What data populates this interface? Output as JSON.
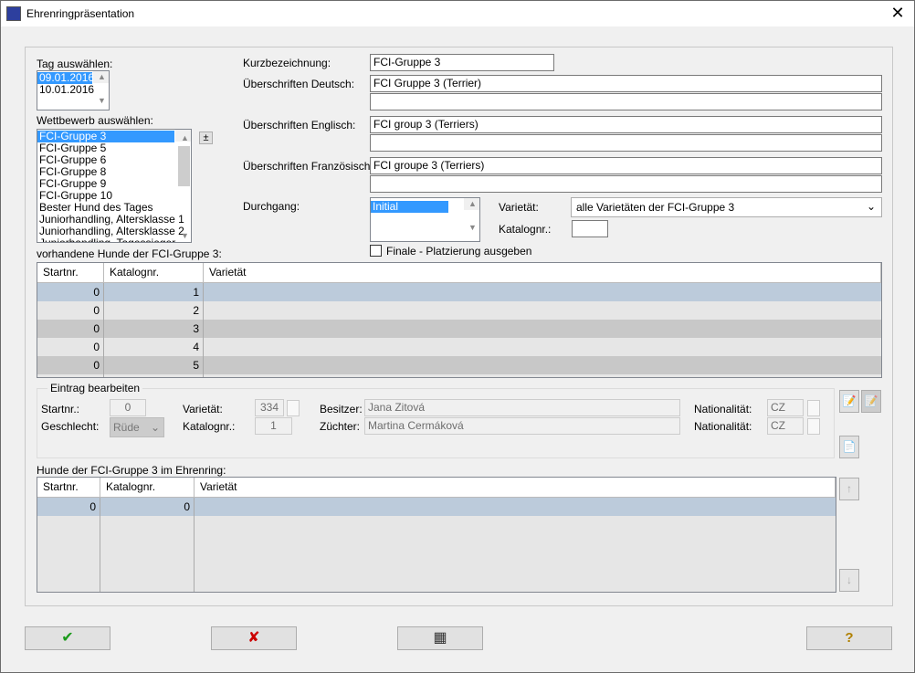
{
  "window": {
    "title": "Ehrenringpräsentation",
    "close": "✕"
  },
  "left": {
    "tag_label": "Tag auswählen:",
    "days": [
      "09.01.2016",
      "10.01.2016"
    ],
    "wettbewerb_label": "Wettbewerb auswählen:",
    "competitions": [
      "FCI-Gruppe 3",
      "FCI-Gruppe 5",
      "FCI-Gruppe 6",
      "FCI-Gruppe 8",
      "FCI-Gruppe 9",
      "FCI-Gruppe 10",
      "Bester Hund des Tages",
      "Juniorhandling, Altersklasse 1",
      "Juniorhandling, Altersklasse 2",
      "Juniorhandling, Tagessieger"
    ],
    "plusminus": "±"
  },
  "form": {
    "kurz_label": "Kurzbezeichnung:",
    "kurz": "FCI-Gruppe 3",
    "de_label": "Überschriften Deutsch:",
    "de1": "FCI Gruppe 3 (Terrier)",
    "de2": "",
    "en_label": "Überschriften Englisch:",
    "en1": "FCI group 3 (Terriers)",
    "en2": "",
    "fr_label": "Überschriften Französisch:",
    "fr1": "FCI groupe 3 (Terriers)",
    "fr2": "",
    "durchgang_label": "Durchgang:",
    "durchgang": [
      "Initial"
    ],
    "varietaet_label": "Varietät:",
    "varietaet": "alle Varietäten der FCI-Gruppe 3",
    "katalog_label": "Katalognr.:",
    "katalog": "",
    "finale_label": "Finale - Platzierung ausgeben"
  },
  "table1": {
    "label": "vorhandene Hunde der FCI-Gruppe 3:",
    "headers": [
      "Startnr.",
      "Katalognr.",
      "Varietät"
    ],
    "rows": [
      [
        "0",
        "1",
        ""
      ],
      [
        "0",
        "2",
        ""
      ],
      [
        "0",
        "3",
        ""
      ],
      [
        "0",
        "4",
        ""
      ],
      [
        "0",
        "5",
        ""
      ]
    ]
  },
  "edit": {
    "legend": "Eintrag bearbeiten",
    "startnr_label": "Startnr.:",
    "startnr": "0",
    "geschlecht_label": "Geschlecht:",
    "geschlecht": "Rüde",
    "var_label": "Varietät:",
    "var": "334",
    "katalog_label": "Katalognr.:",
    "katalog": "1",
    "besitzer_label": "Besitzer:",
    "besitzer": "Jana Zitová",
    "zuechter_label": "Züchter:",
    "zuechter": "Martina Cermáková",
    "nat_label": "Nationalität:",
    "nat1": "CZ",
    "nat2": "CZ"
  },
  "table2": {
    "label": "Hunde der FCI-Gruppe 3 im Ehrenring:",
    "headers": [
      "Startnr.",
      "Katalognr.",
      "Varietät"
    ],
    "rows": [
      [
        "0",
        "0",
        ""
      ]
    ]
  },
  "footer": {
    "ok": "✔",
    "cancel": "✘",
    "calc": "▦",
    "help": "?"
  },
  "colors": {
    "selection": "#3399ff",
    "row_selected": "#bccbdb",
    "row_dark": "#c8c8c8",
    "row_light": "#e6e6e6"
  }
}
